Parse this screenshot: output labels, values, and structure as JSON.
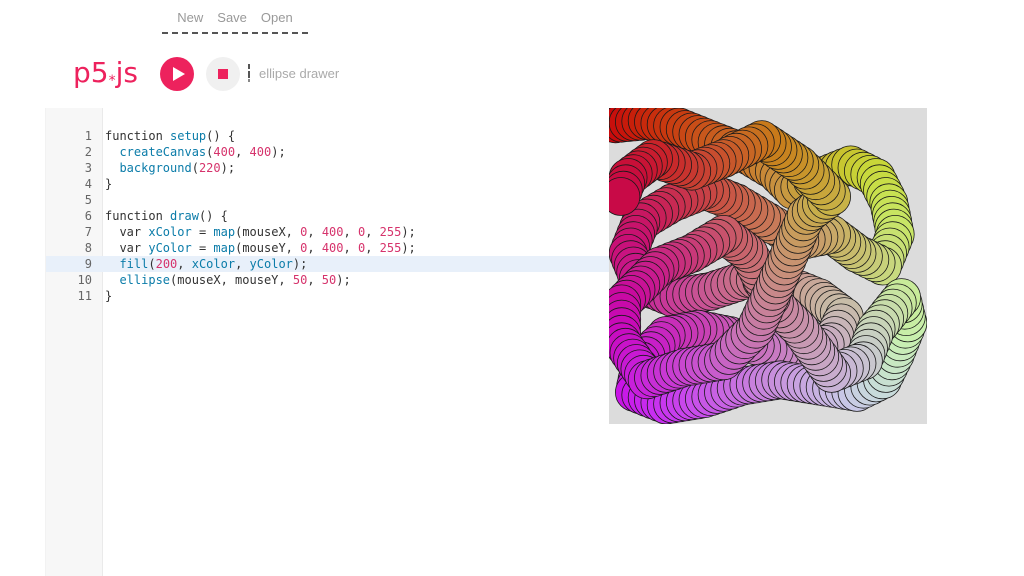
{
  "menu": {
    "new": "New",
    "save": "Save",
    "open": "Open"
  },
  "header": {
    "logo_text": "p5",
    "logo_star": "*",
    "logo_suffix": "js",
    "sketch_name": "ellipse drawer",
    "accent_color": "#ED225D"
  },
  "editor": {
    "lines": [
      {
        "n": "1",
        "text": "function setup() {"
      },
      {
        "n": "2",
        "text": "  createCanvas(400, 400);"
      },
      {
        "n": "3",
        "text": "  background(220);"
      },
      {
        "n": "4",
        "text": "}"
      },
      {
        "n": "5",
        "text": ""
      },
      {
        "n": "6",
        "text": "function draw() {"
      },
      {
        "n": "7",
        "text": "  var xColor = map(mouseX, 0, 400, 0, 255);"
      },
      {
        "n": "8",
        "text": "  var yColor = map(mouseY, 0, 400, 0, 255);"
      },
      {
        "n": "9",
        "text": "  fill(200, xColor, yColor);"
      },
      {
        "n": "10",
        "text": "  ellipse(mouseX, mouseY, 50, 50);"
      },
      {
        "n": "11",
        "text": "}"
      }
    ],
    "active_line": 9
  },
  "preview": {
    "background_color": "#dcdcdc"
  },
  "icons": {
    "play": "play-icon",
    "stop": "stop-icon",
    "edit": "edit-sketch-name-icon"
  }
}
